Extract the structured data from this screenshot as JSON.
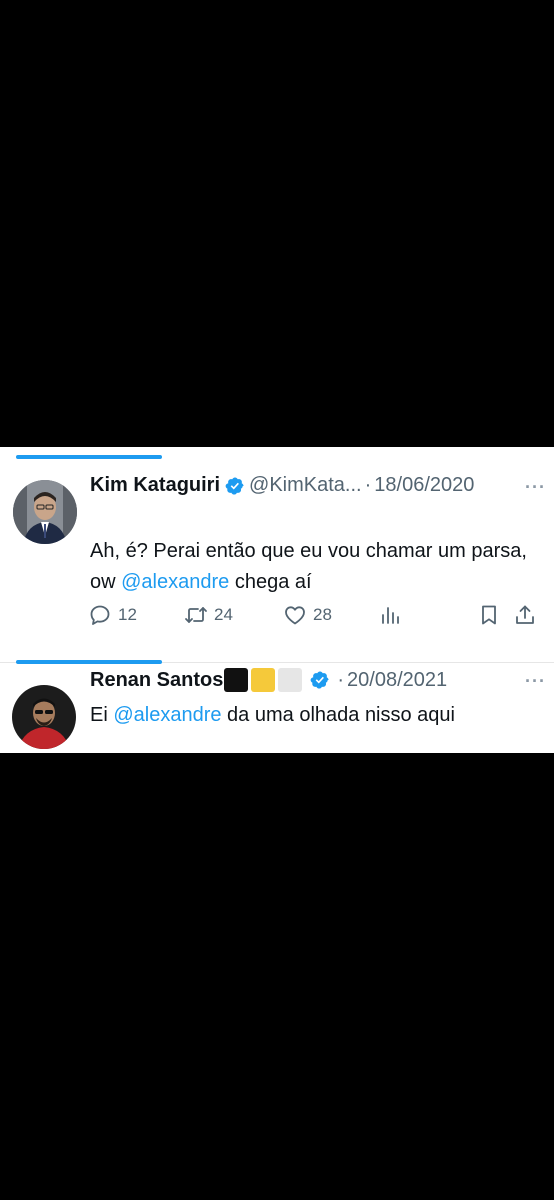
{
  "colors": {
    "accent": "#1d9bf0",
    "verified": "#1d9bf0",
    "text": "#0f1419",
    "secondary": "#536471"
  },
  "tweets": [
    {
      "name": "Kim Kataguiri",
      "handle": "@KimKata...",
      "separator": "·",
      "date": "18/06/2020",
      "more": "···",
      "text_before": "Ah, é? Perai então que eu vou chamar um parsa, ow ",
      "mention": "@alexandre",
      "text_after": " chega aí",
      "replies": "12",
      "retweets": "24",
      "likes": "28",
      "icons": [
        "reply-icon",
        "retweet-icon",
        "like-icon",
        "views-icon",
        "bookmark-icon",
        "share-icon"
      ]
    },
    {
      "name": "Renan Santos",
      "name_emojis": [
        "black-square",
        "yellow-square",
        "white-square"
      ],
      "separator": "·",
      "date": "20/08/2021",
      "more": "···",
      "text_before": "Ei ",
      "mention": "@alexandre",
      "text_after": " da uma olhada nisso aqui"
    }
  ]
}
